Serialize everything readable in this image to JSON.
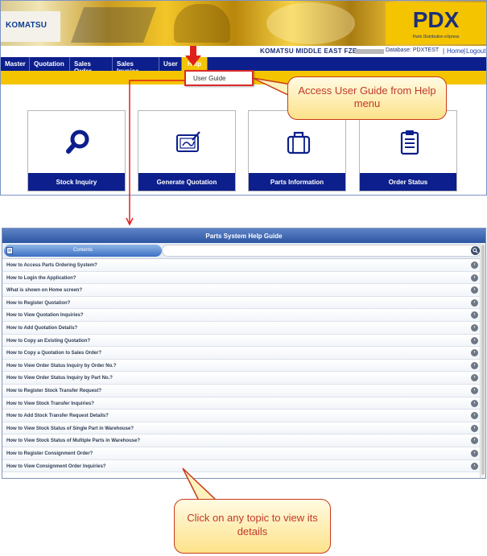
{
  "header": {
    "logo_text": "KOMATSU",
    "brand": "PDX",
    "brand_subtitle": "Parts Distribution eXpress",
    "company": "KOMATSU MIDDLE EAST FZE",
    "database": "Database: PDXTEST",
    "separator": "|",
    "home_link": "Home",
    "logout_link": "Logout"
  },
  "menu": {
    "items": [
      "Master",
      "Quotation",
      "Sales Order",
      "Sales Invoice",
      "User",
      "Help"
    ]
  },
  "help_dropdown": {
    "item": "User Guide"
  },
  "callouts": {
    "help_menu": "Access User Guide from Help menu",
    "topic_hint": "Click on any topic to view its details"
  },
  "cards": [
    {
      "label": "Stock Inquiry",
      "icon": "magnifier-icon"
    },
    {
      "label": "Generate Quotation",
      "icon": "tablet-pen-icon"
    },
    {
      "label": "Parts Information",
      "icon": "briefcase-icon"
    },
    {
      "label": "Order Status",
      "icon": "clipboard-icon"
    }
  ],
  "help_guide": {
    "title": "Parts System Help Guide",
    "contents_tab": "Contents",
    "search_placeholder": "",
    "topics": [
      "How to Access Parts Ordering System?",
      "How to Login the Application?",
      "What is shown on Home screen?",
      "How to Register Quotation?",
      "How to View Quotation Inquiries?",
      "How to Add Quotation Details?",
      "How to Copy an Existing Quotation?",
      "How to Copy a Quotation to Sales Order?",
      "How to View Order Status Inquiry by Order No.?",
      "How to View Order Status Inquiry by Part No.?",
      "How to Register Stock Transfer Request?",
      "How to View Stock Transfer Inquiries?",
      "How to Add Stock Transfer Request Details?",
      "How to View Stock Status of Single Part in Warehouse?",
      "How to View Stock Status of Multiple Parts in Warehouse?",
      "How to Register Consignment Order?",
      "How to View Consignment Order Inquiries?"
    ]
  },
  "colors": {
    "navy": "#0c1f8c",
    "accent_yellow": "#f4c400",
    "highlight_red": "#d92b2b",
    "callout_text": "#c0392b"
  }
}
